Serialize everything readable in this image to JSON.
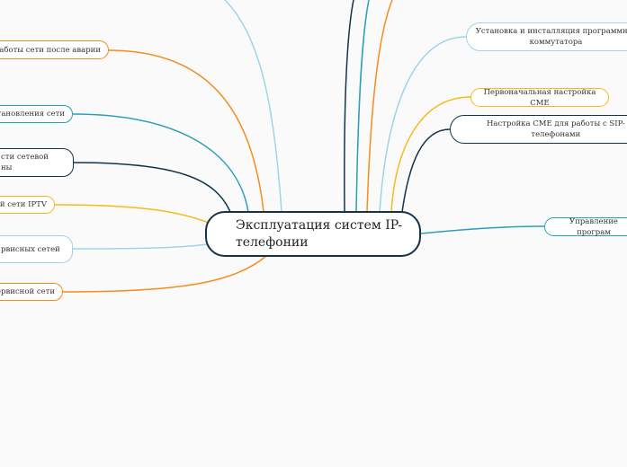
{
  "colors": {
    "orange": "#f68b1f",
    "teal": "#2a9fb8",
    "dark": "#14334a",
    "yellow": "#f9b91b",
    "lightblue": "#9fd3ea"
  },
  "central": {
    "label": "Эксплуатация систем IP-\nтелефонии"
  },
  "left_nodes": [
    {
      "label": "е работы сети после аварии",
      "color": "orange"
    },
    {
      "label": "становления сети",
      "color": "teal"
    },
    {
      "label": "сти сетевой\nны",
      "color": "dark"
    },
    {
      "label": "й сети IPTV",
      "color": "yellow"
    },
    {
      "label": "рвисных сетей\n ",
      "color": "lightblue"
    },
    {
      "label": "сервисной сети",
      "color": "orange"
    }
  ],
  "right_nodes": [
    {
      "label": "Установка и инсталляция программног\nкоммутатора",
      "color": "lightblue"
    },
    {
      "label": "Первоначальная настройка CME",
      "color": "yellow"
    },
    {
      "label": "Настройка CME для работы с SIP-\nтелефонами",
      "color": "dark"
    },
    {
      "label": "Управление програм",
      "color": "teal"
    }
  ]
}
